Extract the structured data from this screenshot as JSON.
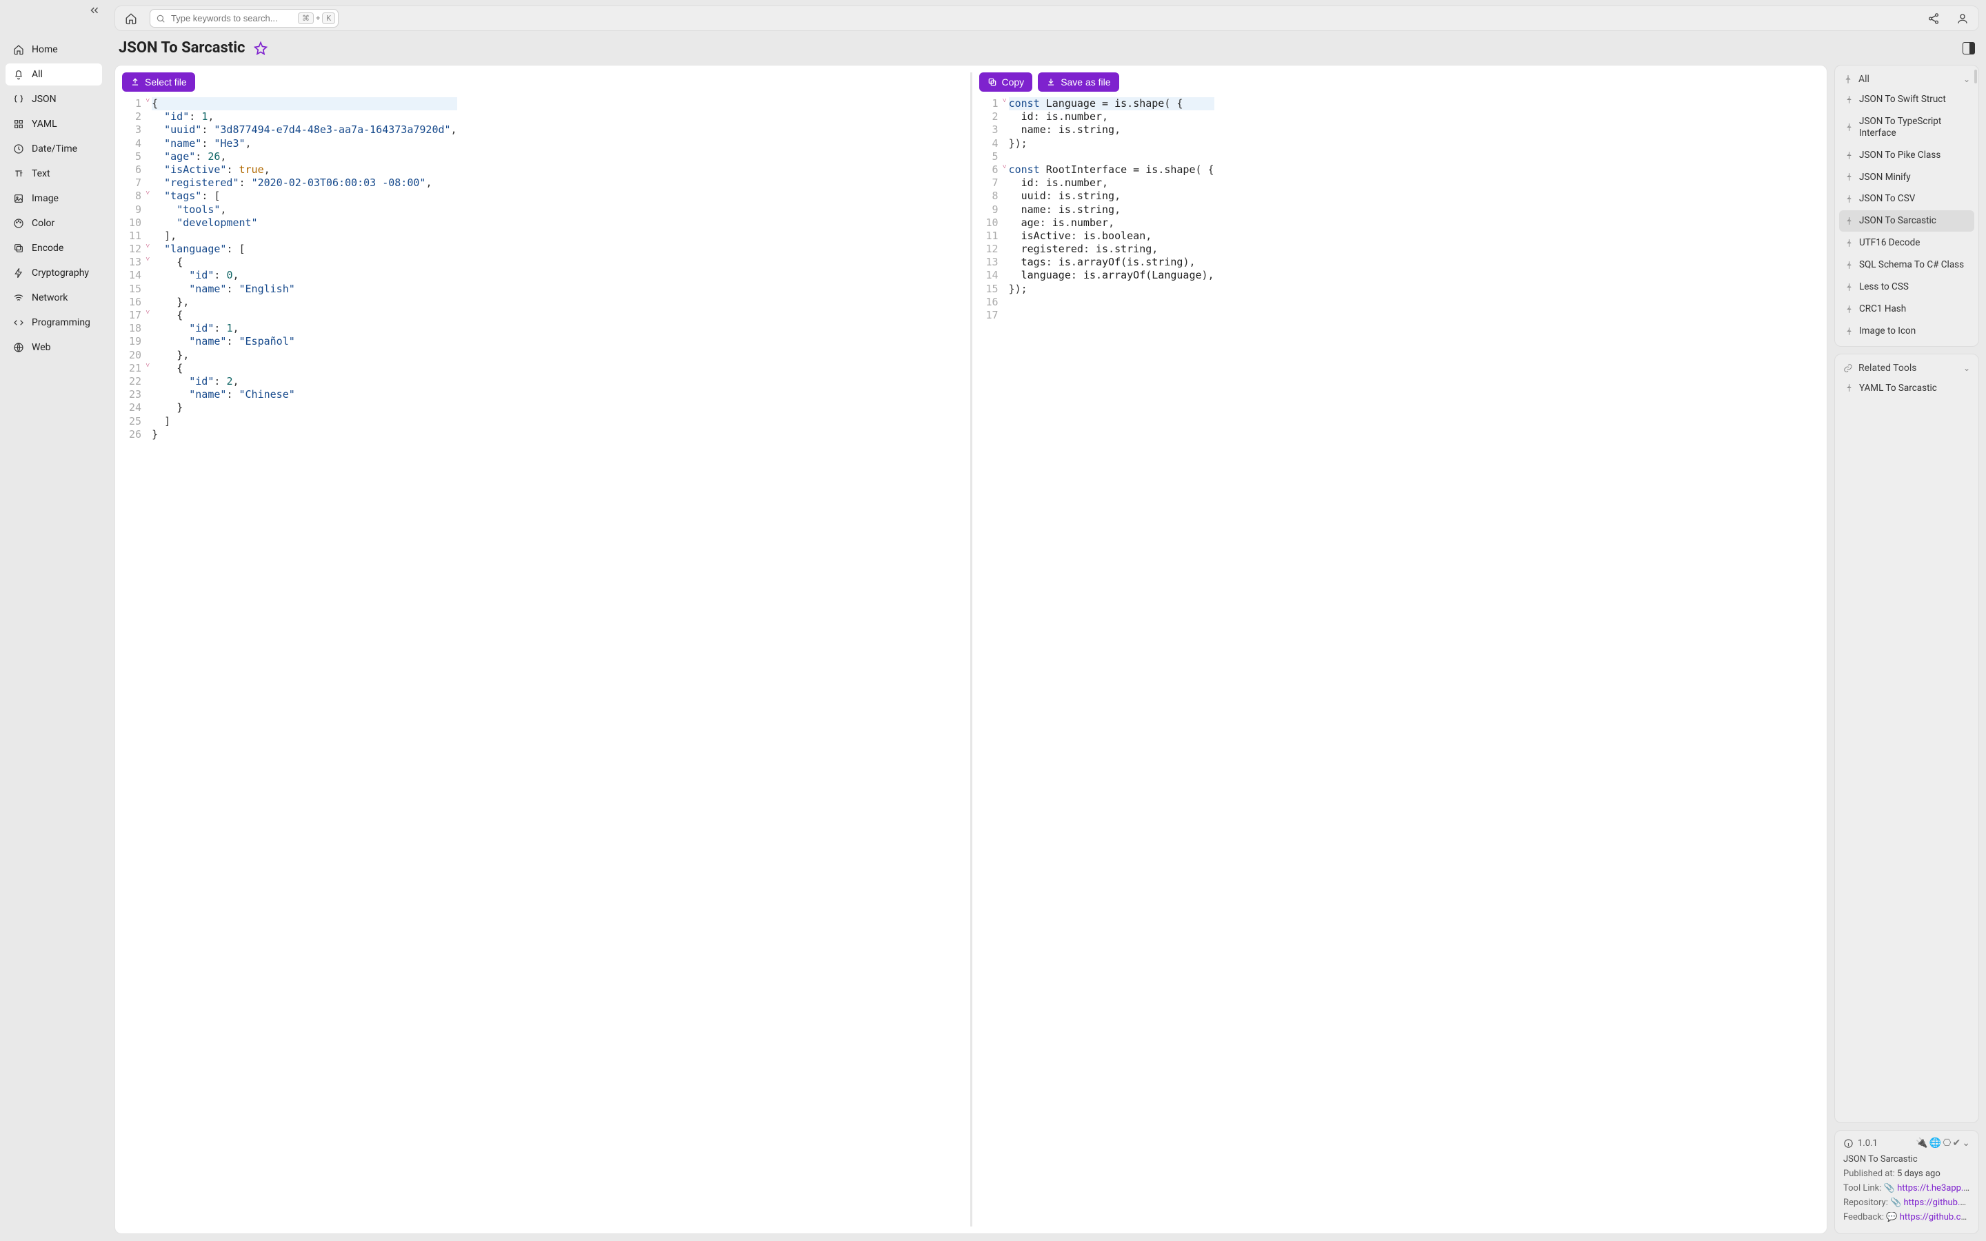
{
  "topbar": {
    "search_placeholder": "Type keywords to search...",
    "kbd_mod": "⌘",
    "kbd_plus": "+",
    "kbd_key": "K"
  },
  "page": {
    "title": "JSON To Sarcastic"
  },
  "sidebar": {
    "items": [
      {
        "label": "Home",
        "icon": "home-icon",
        "active": false
      },
      {
        "label": "All",
        "icon": "bell-icon",
        "active": true
      },
      {
        "label": "JSON",
        "icon": "braces-icon",
        "active": false
      },
      {
        "label": "YAML",
        "icon": "grid-icon",
        "active": false
      },
      {
        "label": "Date/Time",
        "icon": "clock-icon",
        "active": false
      },
      {
        "label": "Text",
        "icon": "text-icon",
        "active": false
      },
      {
        "label": "Image",
        "icon": "image-icon",
        "active": false
      },
      {
        "label": "Color",
        "icon": "palette-icon",
        "active": false
      },
      {
        "label": "Encode",
        "icon": "copy-icon",
        "active": false
      },
      {
        "label": "Cryptography",
        "icon": "bolt-icon",
        "active": false
      },
      {
        "label": "Network",
        "icon": "wifi-icon",
        "active": false
      },
      {
        "label": "Programming",
        "icon": "code-icon",
        "active": false
      },
      {
        "label": "Web",
        "icon": "globe-icon",
        "active": false
      }
    ]
  },
  "buttons": {
    "select_file": "Select file",
    "copy": "Copy",
    "save_file": "Save as file"
  },
  "source_code": [
    {
      "n": 1,
      "fold": true,
      "tokens": [
        [
          "punc",
          "{"
        ]
      ]
    },
    {
      "n": 2,
      "tokens": [
        [
          "sp",
          "  "
        ],
        [
          "key",
          "\"id\""
        ],
        [
          "punc",
          ": "
        ],
        [
          "num",
          "1"
        ],
        [
          "punc",
          ","
        ]
      ]
    },
    {
      "n": 3,
      "tokens": [
        [
          "sp",
          "  "
        ],
        [
          "key",
          "\"uuid\""
        ],
        [
          "punc",
          ": "
        ],
        [
          "str",
          "\"3d877494-e7d4-48e3-aa7a-164373a7920d\""
        ],
        [
          "punc",
          ","
        ]
      ]
    },
    {
      "n": 4,
      "tokens": [
        [
          "sp",
          "  "
        ],
        [
          "key",
          "\"name\""
        ],
        [
          "punc",
          ": "
        ],
        [
          "str",
          "\"He3\""
        ],
        [
          "punc",
          ","
        ]
      ]
    },
    {
      "n": 5,
      "tokens": [
        [
          "sp",
          "  "
        ],
        [
          "key",
          "\"age\""
        ],
        [
          "punc",
          ": "
        ],
        [
          "num",
          "26"
        ],
        [
          "punc",
          ","
        ]
      ]
    },
    {
      "n": 6,
      "tokens": [
        [
          "sp",
          "  "
        ],
        [
          "key",
          "\"isActive\""
        ],
        [
          "punc",
          ": "
        ],
        [
          "bool",
          "true"
        ],
        [
          "punc",
          ","
        ]
      ]
    },
    {
      "n": 7,
      "tokens": [
        [
          "sp",
          "  "
        ],
        [
          "key",
          "\"registered\""
        ],
        [
          "punc",
          ": "
        ],
        [
          "str",
          "\"2020-02-03T06:00:03 -08:00\""
        ],
        [
          "punc",
          ","
        ]
      ]
    },
    {
      "n": 8,
      "fold": true,
      "tokens": [
        [
          "sp",
          "  "
        ],
        [
          "key",
          "\"tags\""
        ],
        [
          "punc",
          ": ["
        ]
      ]
    },
    {
      "n": 9,
      "tokens": [
        [
          "sp",
          "    "
        ],
        [
          "str",
          "\"tools\""
        ],
        [
          "punc",
          ","
        ]
      ]
    },
    {
      "n": 10,
      "tokens": [
        [
          "sp",
          "    "
        ],
        [
          "str",
          "\"development\""
        ]
      ]
    },
    {
      "n": 11,
      "tokens": [
        [
          "sp",
          "  "
        ],
        [
          "punc",
          "],"
        ]
      ]
    },
    {
      "n": 12,
      "fold": true,
      "tokens": [
        [
          "sp",
          "  "
        ],
        [
          "key",
          "\"language\""
        ],
        [
          "punc",
          ": ["
        ]
      ]
    },
    {
      "n": 13,
      "fold": true,
      "tokens": [
        [
          "sp",
          "    "
        ],
        [
          "punc",
          "{"
        ]
      ]
    },
    {
      "n": 14,
      "tokens": [
        [
          "sp",
          "      "
        ],
        [
          "key",
          "\"id\""
        ],
        [
          "punc",
          ": "
        ],
        [
          "num",
          "0"
        ],
        [
          "punc",
          ","
        ]
      ]
    },
    {
      "n": 15,
      "tokens": [
        [
          "sp",
          "      "
        ],
        [
          "key",
          "\"name\""
        ],
        [
          "punc",
          ": "
        ],
        [
          "str",
          "\"English\""
        ]
      ]
    },
    {
      "n": 16,
      "tokens": [
        [
          "sp",
          "    "
        ],
        [
          "punc",
          "},"
        ]
      ]
    },
    {
      "n": 17,
      "fold": true,
      "tokens": [
        [
          "sp",
          "    "
        ],
        [
          "punc",
          "{"
        ]
      ]
    },
    {
      "n": 18,
      "tokens": [
        [
          "sp",
          "      "
        ],
        [
          "key",
          "\"id\""
        ],
        [
          "punc",
          ": "
        ],
        [
          "num",
          "1"
        ],
        [
          "punc",
          ","
        ]
      ]
    },
    {
      "n": 19,
      "tokens": [
        [
          "sp",
          "      "
        ],
        [
          "key",
          "\"name\""
        ],
        [
          "punc",
          ": "
        ],
        [
          "str",
          "\"Español\""
        ]
      ]
    },
    {
      "n": 20,
      "tokens": [
        [
          "sp",
          "    "
        ],
        [
          "punc",
          "},"
        ]
      ]
    },
    {
      "n": 21,
      "fold": true,
      "tokens": [
        [
          "sp",
          "    "
        ],
        [
          "punc",
          "{"
        ]
      ]
    },
    {
      "n": 22,
      "tokens": [
        [
          "sp",
          "      "
        ],
        [
          "key",
          "\"id\""
        ],
        [
          "punc",
          ": "
        ],
        [
          "num",
          "2"
        ],
        [
          "punc",
          ","
        ]
      ]
    },
    {
      "n": 23,
      "tokens": [
        [
          "sp",
          "      "
        ],
        [
          "key",
          "\"name\""
        ],
        [
          "punc",
          ": "
        ],
        [
          "str",
          "\"Chinese\""
        ]
      ]
    },
    {
      "n": 24,
      "tokens": [
        [
          "sp",
          "    "
        ],
        [
          "punc",
          "}"
        ]
      ]
    },
    {
      "n": 25,
      "tokens": [
        [
          "sp",
          "  "
        ],
        [
          "punc",
          "]"
        ]
      ]
    },
    {
      "n": 26,
      "tokens": [
        [
          "punc",
          "}"
        ]
      ]
    }
  ],
  "output_code": [
    {
      "n": 1,
      "fold": true,
      "tokens": [
        [
          "kw",
          "const "
        ],
        [
          "dark",
          "Language"
        ],
        [
          "dark",
          " = "
        ],
        [
          "dark",
          "is"
        ],
        [
          "punc",
          "."
        ],
        [
          "dark",
          "shape"
        ],
        [
          "punc",
          "( {"
        ]
      ]
    },
    {
      "n": 2,
      "tokens": [
        [
          "sp",
          "  "
        ],
        [
          "dark",
          "id"
        ],
        [
          "punc",
          ": "
        ],
        [
          "dark",
          "is"
        ],
        [
          "punc",
          "."
        ],
        [
          "dark",
          "number"
        ],
        [
          "punc",
          ","
        ]
      ]
    },
    {
      "n": 3,
      "tokens": [
        [
          "sp",
          "  "
        ],
        [
          "dark",
          "name"
        ],
        [
          "punc",
          ": "
        ],
        [
          "dark",
          "is"
        ],
        [
          "punc",
          "."
        ],
        [
          "dark",
          "string"
        ],
        [
          "punc",
          ","
        ]
      ]
    },
    {
      "n": 4,
      "tokens": [
        [
          "punc",
          "});"
        ]
      ]
    },
    {
      "n": 5,
      "tokens": []
    },
    {
      "n": 6,
      "fold": true,
      "tokens": [
        [
          "kw",
          "const "
        ],
        [
          "dark",
          "RootInterface"
        ],
        [
          "dark",
          " = "
        ],
        [
          "dark",
          "is"
        ],
        [
          "punc",
          "."
        ],
        [
          "dark",
          "shape"
        ],
        [
          "punc",
          "( {"
        ]
      ]
    },
    {
      "n": 7,
      "tokens": [
        [
          "sp",
          "  "
        ],
        [
          "dark",
          "id"
        ],
        [
          "punc",
          ": "
        ],
        [
          "dark",
          "is"
        ],
        [
          "punc",
          "."
        ],
        [
          "dark",
          "number"
        ],
        [
          "punc",
          ","
        ]
      ]
    },
    {
      "n": 8,
      "tokens": [
        [
          "sp",
          "  "
        ],
        [
          "dark",
          "uuid"
        ],
        [
          "punc",
          ": "
        ],
        [
          "dark",
          "is"
        ],
        [
          "punc",
          "."
        ],
        [
          "dark",
          "string"
        ],
        [
          "punc",
          ","
        ]
      ]
    },
    {
      "n": 9,
      "tokens": [
        [
          "sp",
          "  "
        ],
        [
          "dark",
          "name"
        ],
        [
          "punc",
          ": "
        ],
        [
          "dark",
          "is"
        ],
        [
          "punc",
          "."
        ],
        [
          "dark",
          "string"
        ],
        [
          "punc",
          ","
        ]
      ]
    },
    {
      "n": 10,
      "tokens": [
        [
          "sp",
          "  "
        ],
        [
          "dark",
          "age"
        ],
        [
          "punc",
          ": "
        ],
        [
          "dark",
          "is"
        ],
        [
          "punc",
          "."
        ],
        [
          "dark",
          "number"
        ],
        [
          "punc",
          ","
        ]
      ]
    },
    {
      "n": 11,
      "tokens": [
        [
          "sp",
          "  "
        ],
        [
          "dark",
          "isActive"
        ],
        [
          "punc",
          ": "
        ],
        [
          "dark",
          "is"
        ],
        [
          "punc",
          "."
        ],
        [
          "dark",
          "boolean"
        ],
        [
          "punc",
          ","
        ]
      ]
    },
    {
      "n": 12,
      "tokens": [
        [
          "sp",
          "  "
        ],
        [
          "dark",
          "registered"
        ],
        [
          "punc",
          ": "
        ],
        [
          "dark",
          "is"
        ],
        [
          "punc",
          "."
        ],
        [
          "dark",
          "string"
        ],
        [
          "punc",
          ","
        ]
      ]
    },
    {
      "n": 13,
      "tokens": [
        [
          "sp",
          "  "
        ],
        [
          "dark",
          "tags"
        ],
        [
          "punc",
          ": "
        ],
        [
          "dark",
          "is"
        ],
        [
          "punc",
          "."
        ],
        [
          "dark",
          "arrayOf"
        ],
        [
          "punc",
          "("
        ],
        [
          "dark",
          "is"
        ],
        [
          "punc",
          "."
        ],
        [
          "dark",
          "string"
        ],
        [
          "punc",
          "),"
        ]
      ]
    },
    {
      "n": 14,
      "tokens": [
        [
          "sp",
          "  "
        ],
        [
          "dark",
          "language"
        ],
        [
          "punc",
          ": "
        ],
        [
          "dark",
          "is"
        ],
        [
          "punc",
          "."
        ],
        [
          "dark",
          "arrayOf"
        ],
        [
          "punc",
          "("
        ],
        [
          "dark",
          "Language"
        ],
        [
          "punc",
          "),"
        ]
      ]
    },
    {
      "n": 15,
      "tokens": [
        [
          "punc",
          "});"
        ]
      ]
    },
    {
      "n": 16,
      "tokens": []
    },
    {
      "n": 17,
      "tokens": []
    }
  ],
  "right": {
    "all_header": "All",
    "all_items": [
      {
        "label": "JSON To Swift Struct",
        "active": false
      },
      {
        "label": "JSON To TypeScript Interface",
        "active": false
      },
      {
        "label": "JSON To Pike Class",
        "active": false
      },
      {
        "label": "JSON Minify",
        "active": false
      },
      {
        "label": "JSON To CSV",
        "active": false
      },
      {
        "label": "JSON To Sarcastic",
        "active": true
      },
      {
        "label": "UTF16 Decode",
        "active": false
      },
      {
        "label": "SQL Schema To C# Class",
        "active": false
      },
      {
        "label": "Less to CSS",
        "active": false
      },
      {
        "label": "CRC1 Hash",
        "active": false
      },
      {
        "label": "Image to Icon",
        "active": false
      }
    ],
    "related_header": "Related Tools",
    "related_items": [
      {
        "label": "YAML To Sarcastic"
      }
    ]
  },
  "info": {
    "version": "1.0.1",
    "name": "JSON To Sarcastic",
    "published_label": "Published at:",
    "published_value": "5 days ago",
    "tool_link_label": "Tool Link:",
    "tool_link_value": "https://t.he3app.co…",
    "repo_label": "Repository:",
    "repo_value": "https://github.com…",
    "feedback_label": "Feedback:",
    "feedback_value": "https://github.com/…"
  }
}
